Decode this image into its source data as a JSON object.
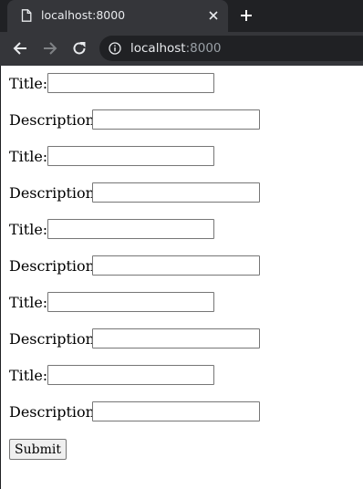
{
  "browser": {
    "tab_title": "localhost:8000",
    "url_host": "localhost",
    "url_port": ":8000",
    "icons": {
      "favicon": "page-icon",
      "tab_close": "close-icon",
      "new_tab": "plus-icon",
      "back": "arrow-left-icon",
      "forward": "arrow-right-icon",
      "reload": "reload-icon",
      "site_info": "info-icon"
    }
  },
  "form": {
    "fields": [
      {
        "label": "Title:",
        "value": ""
      },
      {
        "label": "Description:",
        "value": ""
      },
      {
        "label": "Title:",
        "value": ""
      },
      {
        "label": "Description:",
        "value": ""
      },
      {
        "label": "Title:",
        "value": ""
      },
      {
        "label": "Description:",
        "value": ""
      },
      {
        "label": "Title:",
        "value": ""
      },
      {
        "label": "Description:",
        "value": ""
      },
      {
        "label": "Title:",
        "value": ""
      },
      {
        "label": "Description:",
        "value": ""
      }
    ],
    "submit_label": "Submit"
  }
}
